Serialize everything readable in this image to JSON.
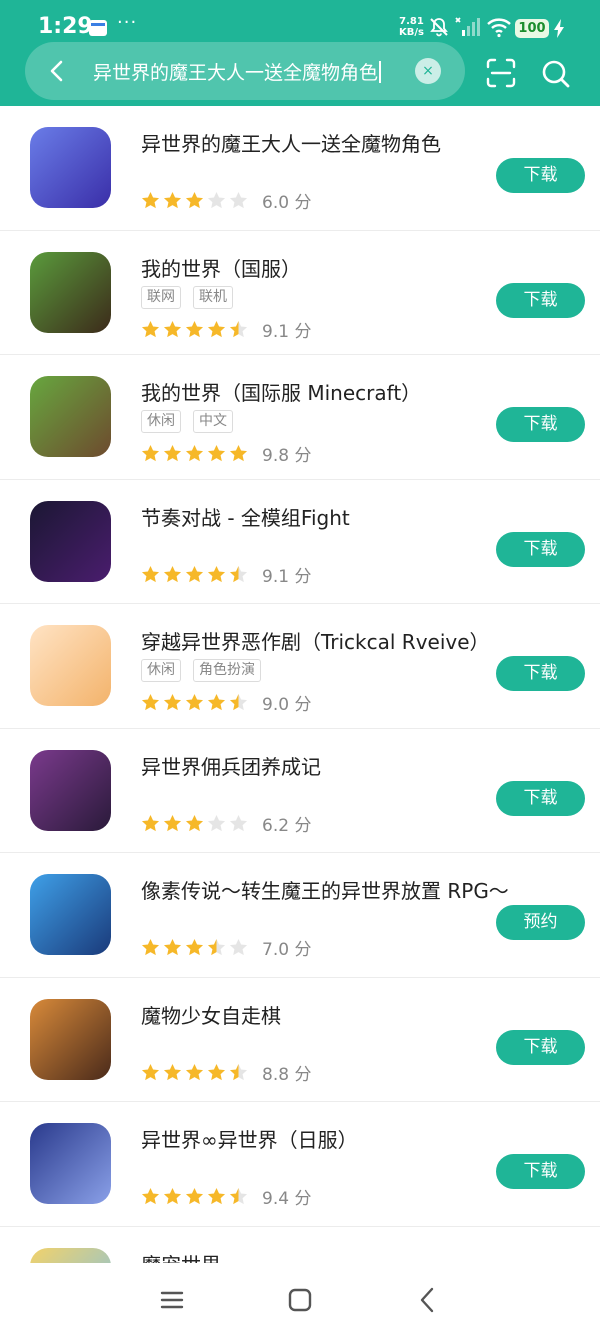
{
  "status_bar": {
    "time": "1:29",
    "dots": "···",
    "speed_value": "7.81",
    "speed_unit": "KB/s",
    "battery": "100"
  },
  "search": {
    "query": "异世界的魔王大人一送全魔物角色",
    "clear_glyph": "×"
  },
  "results": [
    {
      "name": "异世界的魔王大人一送全魔物角色",
      "tags": [],
      "rating": 3,
      "score": "6.0 分",
      "action": "下载",
      "icon_bg": [
        "#6a7de8",
        "#3a2ea8"
      ]
    },
    {
      "name": "我的世界（国服）",
      "tags": [
        "联网",
        "联机"
      ],
      "rating": 4.5,
      "score": "9.1 分",
      "action": "下载",
      "icon_bg": [
        "#5a9b3c",
        "#3c2a1a"
      ]
    },
    {
      "name": "我的世界（国际服 Minecraft）",
      "tags": [
        "休闲",
        "中文"
      ],
      "rating": 5,
      "score": "9.8 分",
      "action": "下载",
      "icon_bg": [
        "#67a73f",
        "#6e4a2e"
      ]
    },
    {
      "name": "节奏对战 - 全模组Fight",
      "tags": [],
      "rating": 4.5,
      "score": "9.1 分",
      "action": "下载",
      "icon_bg": [
        "#1b1733",
        "#4a1d6e"
      ]
    },
    {
      "name": "穿越异世界恶作剧（Trickcal Rveive）",
      "tags": [
        "休闲",
        "角色扮演"
      ],
      "rating": 4.5,
      "score": "9.0 分",
      "action": "下载",
      "icon_bg": [
        "#ffe3c4",
        "#f3b36b"
      ]
    },
    {
      "name": "异世界佣兵团养成记",
      "tags": [],
      "rating": 3,
      "score": "6.2 分",
      "action": "下载",
      "icon_bg": [
        "#7a3a8c",
        "#2a1a3a"
      ]
    },
    {
      "name": "像素传说～转生魔王的异世界放置 RPG～",
      "tags": [],
      "rating": 3.5,
      "score": "7.0 分",
      "action": "预约",
      "icon_bg": [
        "#3fa0e8",
        "#1a3a7a"
      ]
    },
    {
      "name": "魔物少女自走棋",
      "tags": [],
      "rating": 4.5,
      "score": "8.8 分",
      "action": "下载",
      "icon_bg": [
        "#d88a3a",
        "#4a2a1a"
      ]
    },
    {
      "name": "异世界∞异世界（日服）",
      "tags": [],
      "rating": 4.5,
      "score": "9.4 分",
      "action": "下载",
      "icon_bg": [
        "#2a3a8c",
        "#8aa0e8"
      ]
    },
    {
      "name": "魔宠世界",
      "tags": [],
      "rating": 0,
      "score": "",
      "action": "",
      "icon_bg": [
        "#f2d26a",
        "#7ac0e8"
      ]
    }
  ],
  "colors": {
    "accent": "#1fb597",
    "star_filled": "#f6b829",
    "star_empty": "#e5e5e5"
  },
  "icons": {
    "back": "back-arrow-icon",
    "clear": "clear-icon",
    "scan": "scan-icon",
    "search": "search-icon",
    "nav_menu": "menu-icon",
    "nav_home": "home-icon",
    "nav_back": "back-icon"
  }
}
